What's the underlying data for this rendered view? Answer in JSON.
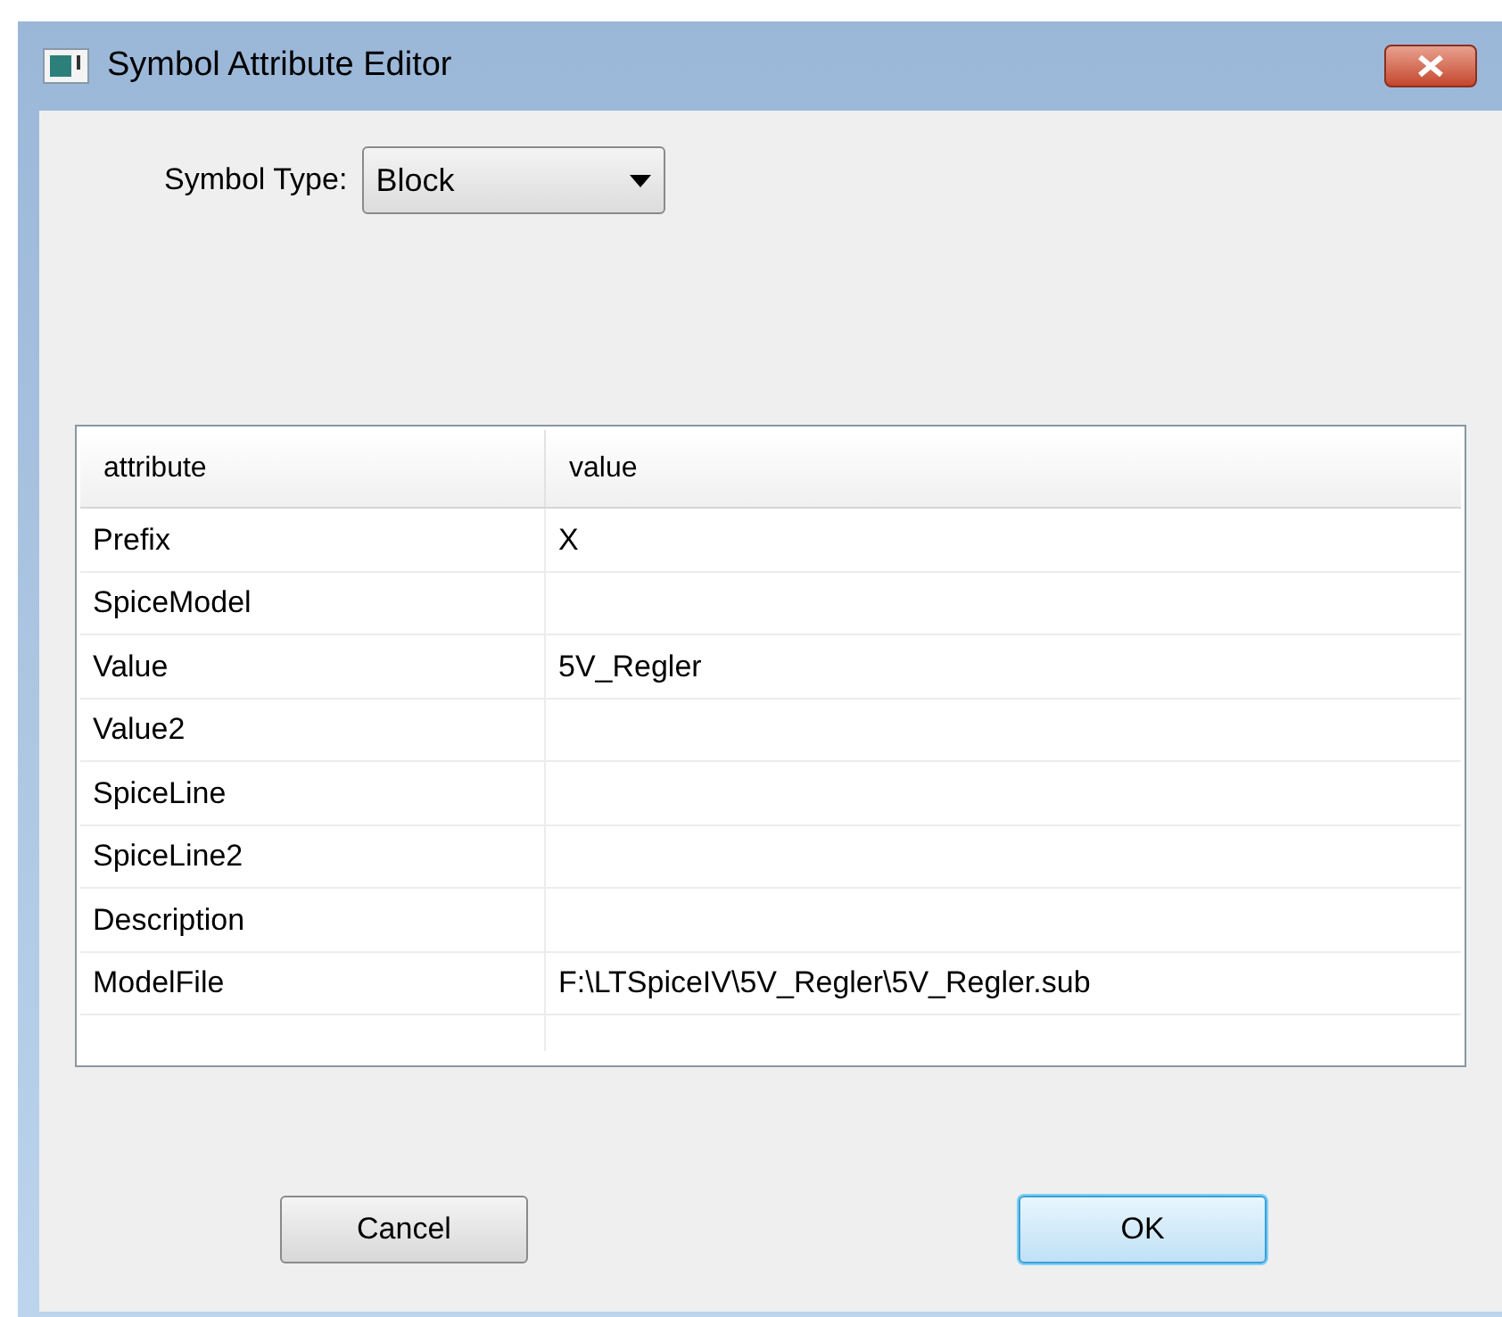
{
  "window": {
    "title": "Symbol Attribute Editor"
  },
  "symbol_type": {
    "label": "Symbol Type:",
    "value": "Block"
  },
  "table": {
    "columns": [
      "attribute",
      "value"
    ],
    "rows": [
      {
        "attribute": "Prefix",
        "value": "X"
      },
      {
        "attribute": "SpiceModel"
      },
      {
        "attribute": "Value",
        "value": "5V_Regler"
      },
      {
        "attribute": "Value2"
      },
      {
        "attribute": "SpiceLine"
      },
      {
        "attribute": "SpiceLine2"
      },
      {
        "attribute": "Description"
      },
      {
        "attribute": "ModelFile",
        "value": "F:\\LTSpiceIV\\5V_Regler\\5V_Regler.sub"
      }
    ]
  },
  "buttons": [
    {
      "label": "Cancel",
      "default": false
    },
    {
      "label": "OK",
      "default": true
    }
  ]
}
